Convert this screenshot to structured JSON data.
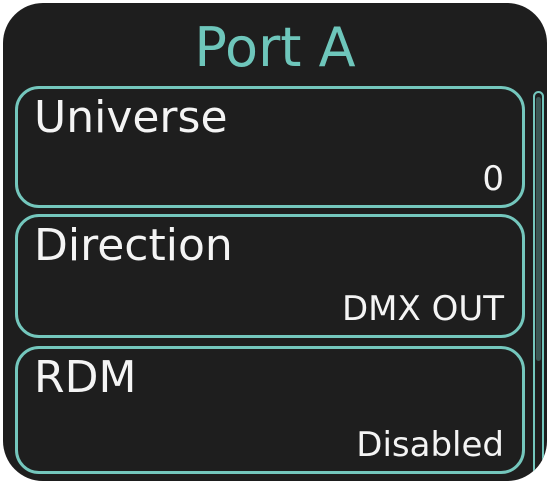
{
  "header": {
    "title": "Port A"
  },
  "menu": {
    "items": [
      {
        "label": "Universe",
        "value": "0"
      },
      {
        "label": "Direction",
        "value": "DMX OUT"
      },
      {
        "label": "RDM",
        "value": "Disabled"
      }
    ]
  },
  "colors": {
    "accent": "#74c7bd",
    "title": "#6ec6bb",
    "background": "#1e1e1e",
    "text": "#f4f4f4"
  }
}
